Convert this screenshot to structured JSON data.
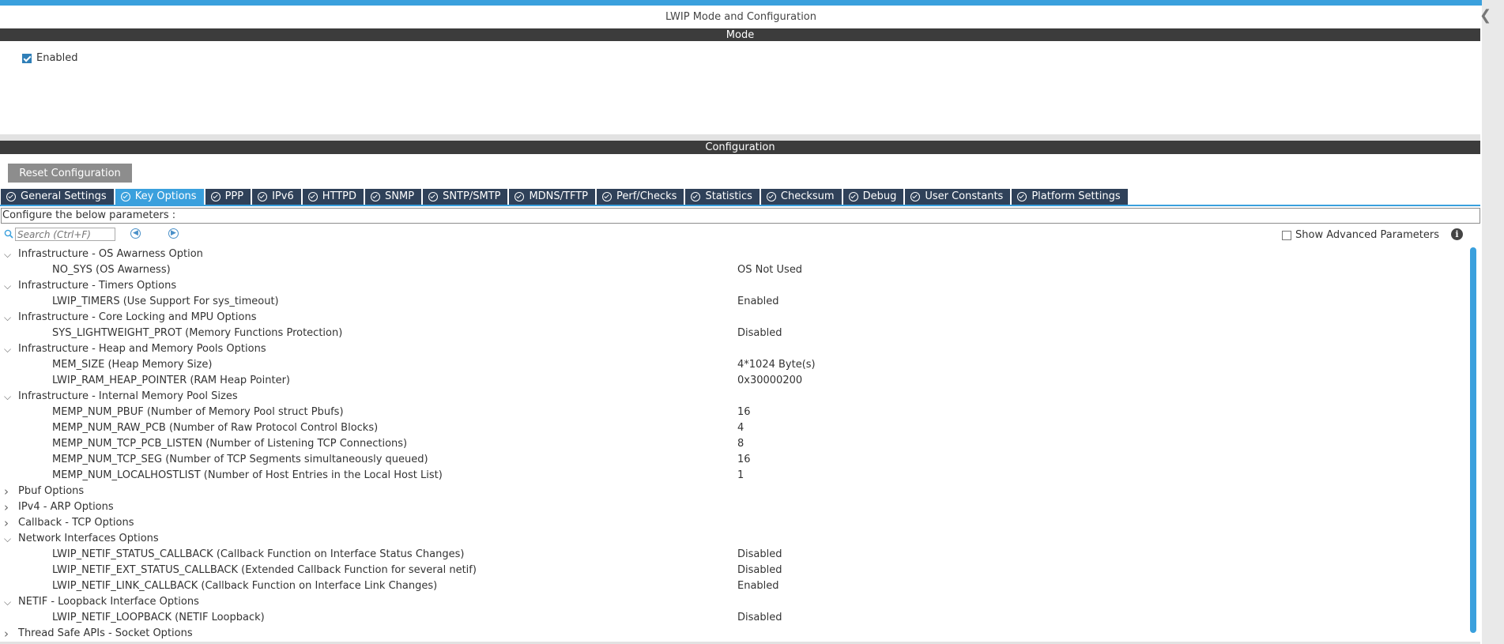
{
  "window": {
    "title": "LWIP Mode and Configuration"
  },
  "mode": {
    "header": "Mode",
    "enabled_label": "Enabled",
    "enabled_checked": true
  },
  "configuration": {
    "header": "Configuration",
    "reset_button": "Reset Configuration",
    "tabs": [
      {
        "label": "General Settings",
        "active": false
      },
      {
        "label": "Key Options",
        "active": true
      },
      {
        "label": "PPP",
        "active": false
      },
      {
        "label": "IPv6",
        "active": false
      },
      {
        "label": "HTTPD",
        "active": false
      },
      {
        "label": "SNMP",
        "active": false
      },
      {
        "label": "SNTP/SMTP",
        "active": false
      },
      {
        "label": "MDNS/TFTP",
        "active": false
      },
      {
        "label": "Perf/Checks",
        "active": false
      },
      {
        "label": "Statistics",
        "active": false
      },
      {
        "label": "Checksum",
        "active": false
      },
      {
        "label": "Debug",
        "active": false
      },
      {
        "label": "User Constants",
        "active": false
      },
      {
        "label": "Platform Settings",
        "active": false
      }
    ],
    "instructions": "Configure the below parameters :",
    "search_placeholder": "Search (Ctrl+F)",
    "show_advanced_label": "Show Advanced Parameters",
    "show_advanced_checked": false
  },
  "tree": [
    {
      "type": "group",
      "label": "Infrastructure - OS Awarness Option",
      "expanded": true
    },
    {
      "type": "param",
      "label": "NO_SYS (OS Awarness)",
      "value": "OS Not Used"
    },
    {
      "type": "group",
      "label": "Infrastructure - Timers Options",
      "expanded": true
    },
    {
      "type": "param",
      "label": "LWIP_TIMERS (Use Support For sys_timeout)",
      "value": "Enabled"
    },
    {
      "type": "group",
      "label": "Infrastructure - Core Locking and MPU Options",
      "expanded": true
    },
    {
      "type": "param",
      "label": "SYS_LIGHTWEIGHT_PROT (Memory Functions Protection)",
      "value": "Disabled"
    },
    {
      "type": "group",
      "label": "Infrastructure - Heap and Memory Pools Options",
      "expanded": true
    },
    {
      "type": "param",
      "label": "MEM_SIZE (Heap Memory Size)",
      "value": "4*1024 Byte(s)"
    },
    {
      "type": "param",
      "label": "LWIP_RAM_HEAP_POINTER (RAM Heap Pointer)",
      "value": "0x30000200"
    },
    {
      "type": "group",
      "label": "Infrastructure - Internal Memory Pool Sizes",
      "expanded": true
    },
    {
      "type": "param",
      "label": "MEMP_NUM_PBUF (Number of Memory Pool struct Pbufs)",
      "value": "16"
    },
    {
      "type": "param",
      "label": "MEMP_NUM_RAW_PCB (Number of Raw Protocol Control Blocks)",
      "value": "4"
    },
    {
      "type": "param",
      "label": "MEMP_NUM_TCP_PCB_LISTEN (Number of Listening TCP Connections)",
      "value": "8"
    },
    {
      "type": "param",
      "label": "MEMP_NUM_TCP_SEG (Number of TCP Segments simultaneously queued)",
      "value": "16"
    },
    {
      "type": "param",
      "label": "MEMP_NUM_LOCALHOSTLIST (Number of Host Entries in the Local Host List)",
      "value": "1"
    },
    {
      "type": "group",
      "label": "Pbuf Options",
      "expanded": false
    },
    {
      "type": "group",
      "label": "IPv4 - ARP Options",
      "expanded": false
    },
    {
      "type": "group",
      "label": "Callback - TCP Options",
      "expanded": false
    },
    {
      "type": "group",
      "label": "Network Interfaces Options",
      "expanded": true
    },
    {
      "type": "param",
      "label": "LWIP_NETIF_STATUS_CALLBACK (Callback Function on Interface Status Changes)",
      "value": "Disabled"
    },
    {
      "type": "param",
      "label": "LWIP_NETIF_EXT_STATUS_CALLBACK (Extended Callback Function for several netif)",
      "value": "Disabled"
    },
    {
      "type": "param",
      "label": "LWIP_NETIF_LINK_CALLBACK (Callback Function on Interface Link Changes)",
      "value": "Enabled"
    },
    {
      "type": "group",
      "label": "NETIF - Loopback Interface Options",
      "expanded": true
    },
    {
      "type": "param",
      "label": "LWIP_NETIF_LOOPBACK (NETIF Loopback)",
      "value": "Disabled"
    },
    {
      "type": "group",
      "label": "Thread Safe APIs - Socket Options",
      "expanded": false
    }
  ],
  "colors": {
    "accent": "#3aa0dd",
    "tab_bg": "#2f4159",
    "header_bg": "#3c3c3c",
    "button_gray": "#8d8d8d"
  },
  "icons": {
    "tab_check": "check-circle-icon",
    "search": "search-icon",
    "prev": "arrow-left-circle-icon",
    "next": "arrow-right-circle-icon",
    "info": "info-icon",
    "expanded": "chevron-down-icon",
    "collapsed": "chevron-right-icon"
  }
}
